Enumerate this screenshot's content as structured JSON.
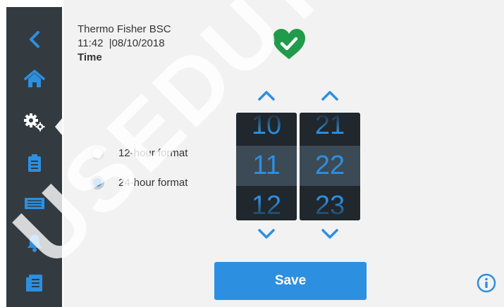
{
  "header": {
    "device_name": "Thermo Fisher BSC",
    "time": "11:42",
    "separator": "|",
    "date": "08/10/2018",
    "page_title": "Time"
  },
  "status_icon": "heart-check-icon",
  "sidebar": {
    "items": [
      {
        "icon": "back-chevron-icon"
      },
      {
        "icon": "home-icon"
      },
      {
        "icon": "settings-gears-icon",
        "active": true
      },
      {
        "icon": "clipboard-log-icon"
      },
      {
        "icon": "filter-icon"
      },
      {
        "icon": "bell-icon"
      },
      {
        "icon": "list-document-icon"
      }
    ]
  },
  "time_format": {
    "options": [
      {
        "label": "12-hour format",
        "selected": false
      },
      {
        "label": "24-hour format",
        "selected": true
      }
    ]
  },
  "hour_picker": {
    "prev": "10",
    "current": "11",
    "next": "12"
  },
  "minute_picker": {
    "prev": "21",
    "current": "22",
    "next": "23"
  },
  "save_label": "Save",
  "watermark": "USEDUTS",
  "colors": {
    "accent": "#2d8fe0",
    "sidebar": "#333b41",
    "status_ok": "#1f9b4b"
  }
}
